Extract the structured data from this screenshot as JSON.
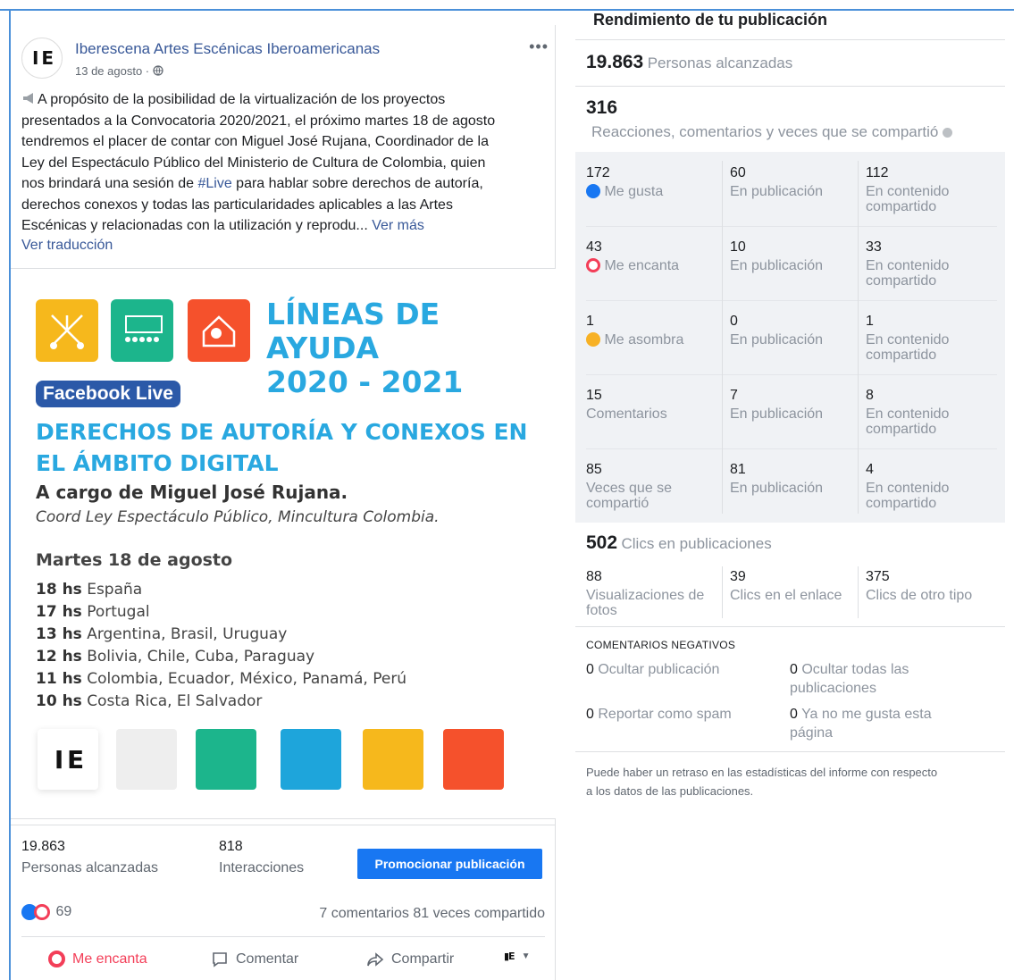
{
  "post": {
    "page_name": "Iberescena Artes Escénicas Iberoamericanas",
    "avatar_text": "I E",
    "date": "13 de agosto · ",
    "more": "•••",
    "text_line1": "A propósito de la posibilidad de la virtualización de los proyectos",
    "text_line2": "presentados a la Convocatoria 2020/2021, el próximo martes 18 de agosto",
    "text_line3": "tendremos el placer de contar con Miguel José Rujana, Coordinador de la",
    "text_line4": "Ley del Espectáculo Público del Ministerio de Cultura de Colombia, quien",
    "text_line5a": "nos brindará una sesión de ",
    "hashtag": "#Live",
    "text_line5b": " para hablar sobre derechos de autoría,",
    "text_line6": "derechos conexos y todas las particularidades aplicables a las Artes",
    "text_line7": "Escénicas y relacionadas con la utilización y reprodu... ",
    "see_more": "Ver más",
    "see_translation": "Ver traducción"
  },
  "poster": {
    "title_line1": "LÍNEAS DE AYUDA",
    "title_line2": "2020 - 2021",
    "badge": "Facebook Live",
    "subtitle_line1": "DERECHOS DE AUTORÍA Y CONEXOS EN",
    "subtitle_line2": "EL ÁMBITO DIGITAL",
    "by": "A cargo de Miguel José Rujana.",
    "role": "Coord Ley Espectáculo Público, Mincultura Colombia.",
    "date": "Martes 18 de agosto",
    "times": [
      {
        "h": "18 hs",
        "place": " España"
      },
      {
        "h": "17 hs",
        "place": " Portugal"
      },
      {
        "h": "13 hs",
        "place": " Argentina, Brasil, Uruguay"
      },
      {
        "h": "12 hs",
        "place": " Bolivia, Chile, Cuba, Paraguay"
      },
      {
        "h": "11 hs",
        "place": " Colombia, Ecuador, México, Panamá, Perú"
      },
      {
        "h": "10 hs",
        "place": " Costa Rica, El Salvador"
      }
    ],
    "logo": "I E",
    "colors": {
      "yellow": "#f6b81c",
      "green": "#1cb58c",
      "blue": "#1ea5db",
      "red": "#f5512c",
      "gray": "#eeeeee"
    }
  },
  "footer": {
    "reach_value": "19.863",
    "reach_label": "Personas alcanzadas",
    "interactions_value": "818",
    "interactions_label": "Interacciones",
    "promote": "Promocionar publicación",
    "reactions_count": "69",
    "comments_shares": "7 comentarios  81 veces compartido",
    "love_action": "Me encanta",
    "comment_action": "Comentar",
    "share_action": "Compartir"
  },
  "panel": {
    "title": "Rendimiento de tu publicación",
    "reach_value": "19.863",
    "reach_label": "Personas alcanzadas",
    "engage_value": "316",
    "engage_label": "Reacciones, comentarios y veces que se compartió",
    "rows": [
      {
        "v1": "172",
        "l1": "Me gusta",
        "v2": "60",
        "l2": "En publicación",
        "v3": "112",
        "l3a": "En contenido",
        "l3b": "compartido"
      },
      {
        "v1": "43",
        "l1": "Me encanta",
        "v2": "10",
        "l2": "En publicación",
        "v3": "33",
        "l3a": "En contenido",
        "l3b": "compartido"
      },
      {
        "v1": "1",
        "l1": "Me asombra",
        "v2": "0",
        "l2": "En publicación",
        "v3": "1",
        "l3a": "En contenido",
        "l3b": "compartido"
      },
      {
        "v1": "15",
        "l1": "Comentarios",
        "v2": "7",
        "l2": "En publicación",
        "v3": "8",
        "l3a": "En contenido",
        "l3b": "compartido"
      },
      {
        "v1": "85",
        "l1a": "Veces que se",
        "l1b": "compartió",
        "v2": "81",
        "l2": "En publicación",
        "v3": "4",
        "l3a": "En contenido",
        "l3b": "compartido"
      }
    ],
    "clicks_value": "502",
    "clicks_label": "Clics en publicaciones",
    "clicks": [
      {
        "v": "88",
        "la": "Visualizaciones de",
        "lb": "fotos"
      },
      {
        "v": "39",
        "la": "Clics en el enlace"
      },
      {
        "v": "375",
        "la": "Clics de otro tipo"
      }
    ],
    "negative_title": "COMENTARIOS NEGATIVOS",
    "negatives": [
      {
        "v": "0",
        "la": "Ocultar publicación"
      },
      {
        "v": "0",
        "la": "Ocultar todas las",
        "lb": "publicaciones"
      },
      {
        "v": "0",
        "la": "Reportar como spam"
      },
      {
        "v": "0",
        "la": "Ya no me gusta esta",
        "lb": "página"
      }
    ],
    "note_line1": "Puede haber un retraso en las estadísticas del informe con respecto",
    "note_line2": "a los datos de las publicaciones."
  }
}
